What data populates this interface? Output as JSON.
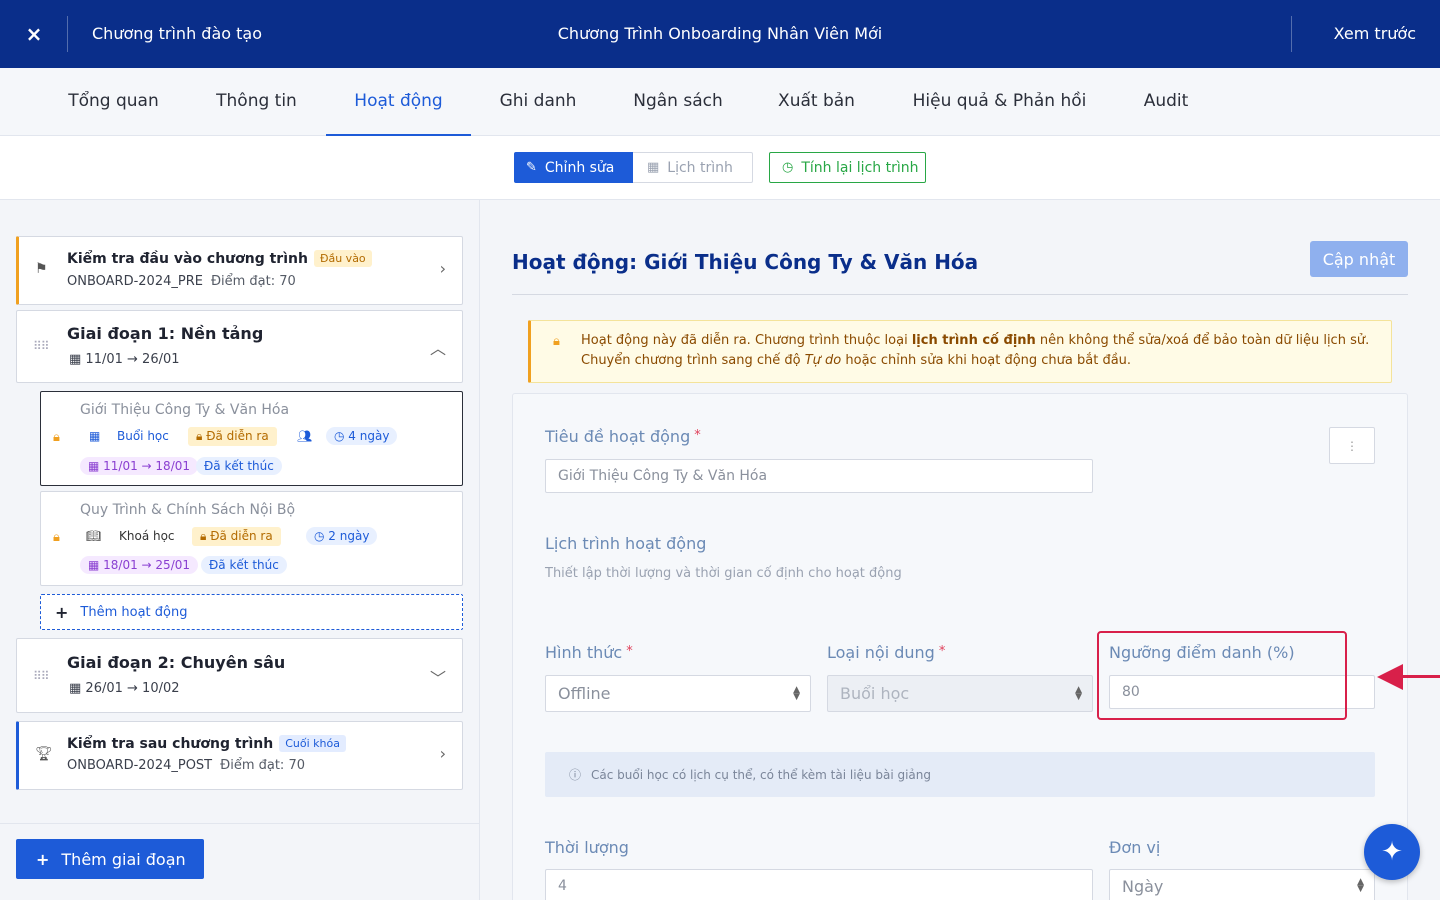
{
  "topbar": {
    "close_icon": "×",
    "breadcrumb": "Chương trình đào tạo",
    "title": "Chương Trình Onboarding Nhân Viên Mới",
    "preview": "Xem trước"
  },
  "tabs": [
    {
      "label": "Tổng quan"
    },
    {
      "label": "Thông tin"
    },
    {
      "label": "Hoạt động"
    },
    {
      "label": "Ghi danh"
    },
    {
      "label": "Ngân sách"
    },
    {
      "label": "Xuất bản"
    },
    {
      "label": "Hiệu quả & Phản hồi"
    },
    {
      "label": "Audit"
    }
  ],
  "active_tab": "Hoạt động",
  "toolbar": {
    "edit": "Chỉnh sửa",
    "schedule": "Lịch trình",
    "recalc": "Tính lại lịch trình"
  },
  "left": {
    "pre_test": {
      "title": "Kiểm tra đầu vào chương trình",
      "badge": "Đầu vào",
      "code": "ONBOARD-2024_PRE",
      "score": "Điểm đạt: 70"
    },
    "stage1": {
      "title": "Giai đoạn 1: Nền tảng",
      "dates": "11/01 → 26/01",
      "activities": [
        {
          "title": "Giới Thiệu Công Ty & Văn Hóa",
          "type": "Buổi học",
          "status": "Đã diễn ra",
          "duration": "4 ngày",
          "dates": "11/01 → 18/01",
          "state": "Đã kết thúc"
        },
        {
          "title": "Quy Trình & Chính Sách Nội Bộ",
          "type": "Khoá học",
          "status": "Đã diễn ra",
          "duration": "2 ngày",
          "dates": "18/01 → 25/01",
          "state": "Đã kết thúc"
        }
      ],
      "add_activity": "Thêm hoạt động"
    },
    "stage2": {
      "title": "Giai đoạn 2: Chuyên sâu",
      "dates": "26/01 → 10/02"
    },
    "post_test": {
      "title": "Kiểm tra sau chương trình",
      "badge": "Cuối khóa",
      "code": "ONBOARD-2024_POST",
      "score": "Điểm đạt: 70"
    },
    "add_stage": "Thêm giai đoạn"
  },
  "right": {
    "title": "Hoạt động: Giới Thiệu Công Ty & Văn Hóa",
    "update_button": "Cập nhật",
    "alert": {
      "pre": "Hoạt động này đã diễn ra. Chương trình thuộc loại ",
      "bold": "lịch trình cố định",
      "mid": " nên không thể sửa/xoá để bảo toàn dữ liệu lịch sử. Chuyển chương trình sang chế độ ",
      "italic": "Tự do",
      "post": " hoặc chỉnh sửa khi hoạt động chưa bắt đầu."
    },
    "form": {
      "title_label": "Tiêu đề hoạt động",
      "title_value": "Giới Thiệu Công Ty & Văn Hóa",
      "schedule_heading": "Lịch trình hoạt động",
      "schedule_hint": "Thiết lập thời lượng và thời gian cố định cho hoạt động",
      "format_label": "Hình thức",
      "format_value": "Offline",
      "content_type_label": "Loại nội dung",
      "content_type_value": "Buổi học",
      "attendance_label": "Ngưỡng điểm danh (%)",
      "attendance_value": "80",
      "info": "Các buổi học có lịch cụ thể, có thể kèm tài liệu bài giảng",
      "duration_label": "Thời lượng",
      "duration_value": "4",
      "unit_label": "Đơn vị",
      "unit_value": "Ngày"
    }
  },
  "colors": {
    "primary": "#1d5bd8",
    "navy": "#0a2e8a",
    "highlight": "#d8204a",
    "warning": "#f0a020",
    "success": "#28a745"
  }
}
